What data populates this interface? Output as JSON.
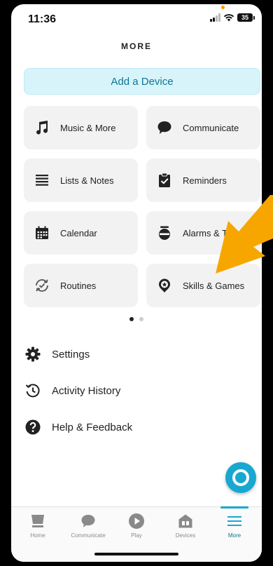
{
  "status_bar": {
    "time": "11:36",
    "battery": "35"
  },
  "header": {
    "title": "MORE"
  },
  "add_device": {
    "label": "Add a Device"
  },
  "tiles": [
    {
      "label": "Music & More",
      "icon": "music-note-icon"
    },
    {
      "label": "Communicate",
      "icon": "speech-bubble-icon"
    },
    {
      "label": "Lists & Notes",
      "icon": "list-icon"
    },
    {
      "label": "Reminders",
      "icon": "clipboard-check-icon"
    },
    {
      "label": "Calendar",
      "icon": "calendar-icon"
    },
    {
      "label": "Alarms & Tim",
      "icon": "alarm-clock-icon"
    },
    {
      "label": "Routines",
      "icon": "routines-icon"
    },
    {
      "label": "Skills & Games",
      "icon": "skills-badge-icon"
    }
  ],
  "pager": {
    "pages": 2,
    "current": 1
  },
  "menu": [
    {
      "label": "Settings",
      "icon": "gear-icon"
    },
    {
      "label": "Activity History",
      "icon": "history-clock-icon"
    },
    {
      "label": "Help & Feedback",
      "icon": "help-icon"
    }
  ],
  "tabs": [
    {
      "label": "Home",
      "icon": "home-device-icon"
    },
    {
      "label": "Communicate",
      "icon": "chat-bubble-icon"
    },
    {
      "label": "Play",
      "icon": "play-icon"
    },
    {
      "label": "Devices",
      "icon": "devices-house-icon"
    },
    {
      "label": "More",
      "icon": "hamburger-menu-icon"
    }
  ],
  "colors": {
    "accent": "#17a8d1",
    "accent_text": "#0b7792",
    "add_device_bg": "#d8f4fb",
    "tile_bg": "#f2f2f2",
    "annotation_arrow": "#f7a600"
  }
}
